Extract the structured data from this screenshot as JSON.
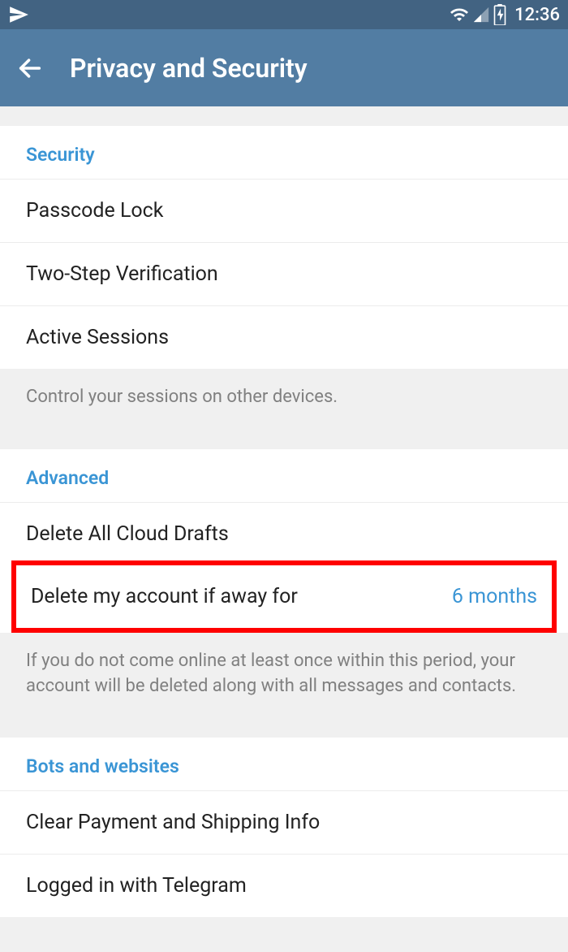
{
  "status": {
    "time": "12:36"
  },
  "header": {
    "title": "Privacy and Security"
  },
  "sections": {
    "security": {
      "title": "Security",
      "items": {
        "passcode": "Passcode Lock",
        "twostep": "Two-Step Verification",
        "sessions": "Active Sessions"
      },
      "footer": "Control your sessions on other devices."
    },
    "advanced": {
      "title": "Advanced",
      "items": {
        "drafts": "Delete All Cloud Drafts",
        "delete_account_label": "Delete my account if away for",
        "delete_account_value": "6 months"
      },
      "footer": "If you do not come online at least once within this period, your account will be deleted along with all messages and contacts."
    },
    "bots": {
      "title": "Bots and websites",
      "items": {
        "clear_payment": "Clear Payment and Shipping Info",
        "logged_in": "Logged in with Telegram"
      }
    }
  }
}
